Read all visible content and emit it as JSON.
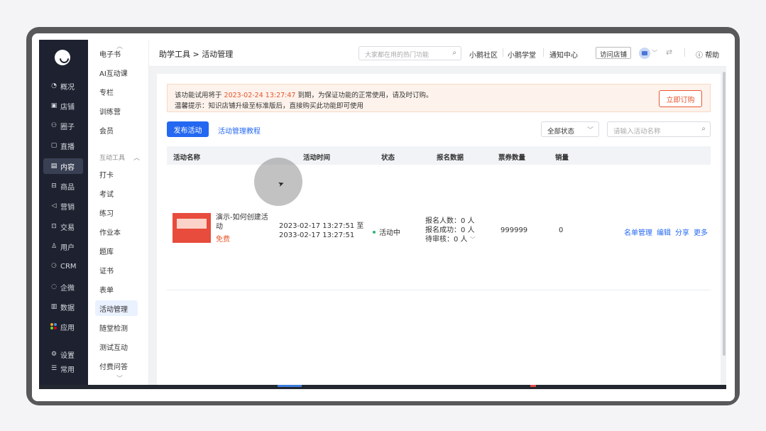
{
  "leftnav": {
    "items": [
      {
        "label": "概况",
        "icon": "pie-icon"
      },
      {
        "label": "店铺",
        "icon": "store-icon"
      },
      {
        "label": "圈子",
        "icon": "circle-group-icon"
      },
      {
        "label": "直播",
        "icon": "live-icon"
      },
      {
        "label": "内容",
        "icon": "content-icon"
      },
      {
        "label": "商品",
        "icon": "goods-icon"
      },
      {
        "label": "营销",
        "icon": "megaphone-icon"
      },
      {
        "label": "交易",
        "icon": "trade-icon"
      },
      {
        "label": "用户",
        "icon": "user-icon"
      },
      {
        "label": "CRM",
        "icon": "crm-icon"
      },
      {
        "label": "企微",
        "icon": "wecom-icon"
      },
      {
        "label": "数据",
        "icon": "data-icon"
      },
      {
        "label": "应用",
        "icon": "apps-icon"
      },
      {
        "label": "设置",
        "icon": "settings-icon"
      },
      {
        "label": "常用",
        "icon": "common-icon"
      }
    ],
    "active": "内容"
  },
  "submenu": {
    "top_items": [
      "电子书",
      "AI互动课",
      "专栏",
      "训练营",
      "会员"
    ],
    "group_label": "互动工具",
    "group_items": [
      "打卡",
      "考试",
      "练习",
      "作业本",
      "题库",
      "证书",
      "表单",
      "活动管理",
      "随堂检测",
      "测试互动",
      "付费问答"
    ],
    "active": "活动管理"
  },
  "topbar": {
    "breadcrumb": "助学工具 > 活动管理",
    "search_placeholder": "大家都在用的热门功能",
    "links": [
      "小鹅社区",
      "小鹅学堂",
      "通知中心"
    ],
    "visit_store": "访问店铺",
    "help": "帮助"
  },
  "notice": {
    "line1_prefix": "该功能试用将于",
    "line1_date": "2023-02-24 13:27:47",
    "line1_suffix": "到期，为保证功能的正常使用，请及时订购。",
    "line2": "温馨提示：知识店铺升级至标准版后，直接购买此功能即可使用",
    "order_button": "立即订购"
  },
  "toolbar": {
    "publish_button": "发布活动",
    "tutorial_link": "活动管理教程",
    "status_select": "全部状态",
    "name_search_placeholder": "请输入活动名称"
  },
  "table": {
    "headers": [
      "活动名称",
      "活动时间",
      "状态",
      "报名数据",
      "票券数量",
      "销量"
    ],
    "rows": [
      {
        "title": "演示-如何创建活动",
        "price": "免费",
        "time_start": "2023-02-17 13:27:51 至",
        "time_end": "2033-02-17 13:27:51",
        "status": "活动中",
        "signup_count": "报名人数：0 人",
        "signup_success": "报名成功：0 人",
        "signup_pending": "待审核：0 人",
        "tickets": "999999",
        "sales": "0",
        "ops": [
          "名单管理",
          "编辑",
          "分享",
          "更多"
        ]
      }
    ]
  },
  "colors": {
    "primary": "#2468f2",
    "warning": "#e8562e",
    "nav_bg": "#1e2230",
    "success_dot": "#2bb673"
  }
}
